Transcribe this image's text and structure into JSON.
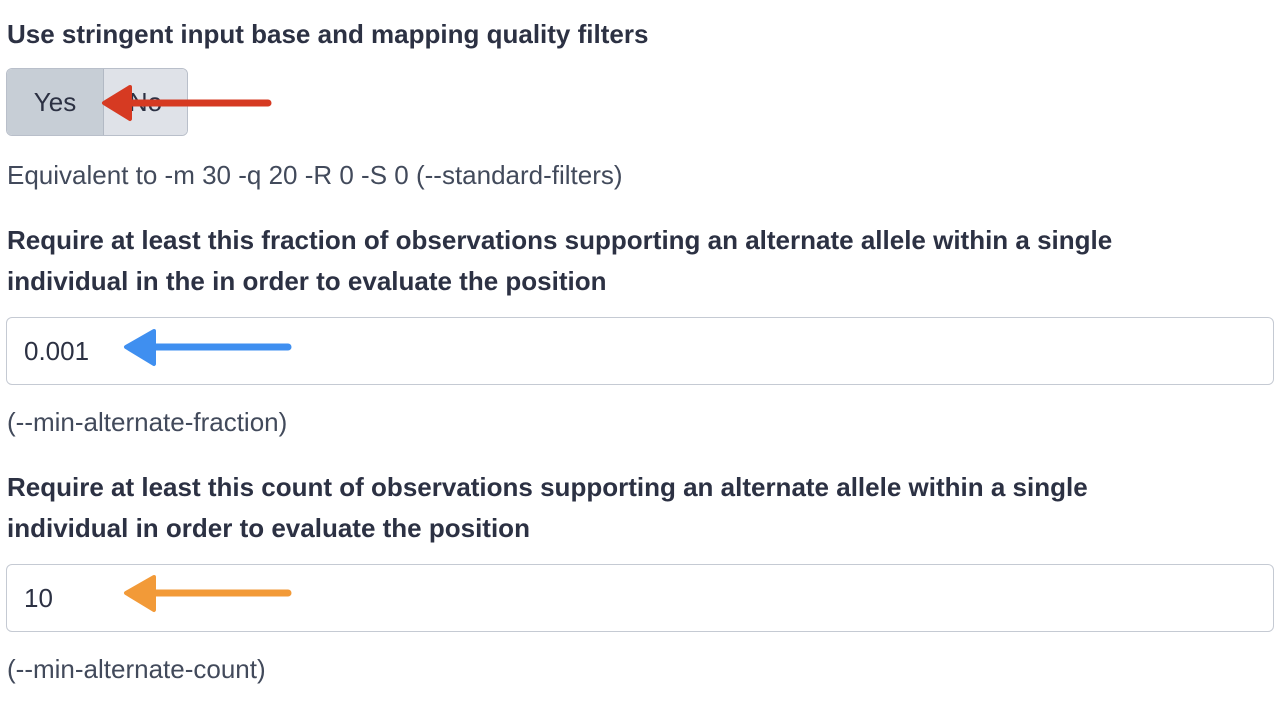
{
  "stringent_filters": {
    "label": "Use stringent input base and mapping quality filters",
    "options": [
      "Yes",
      "No"
    ],
    "selected": "Yes",
    "help": "Equivalent to -m 30 -q 20 -R 0 -S 0 (--standard-filters)"
  },
  "min_alternate_fraction": {
    "label_line1": "Require at least this fraction of observations supporting an alternate allele within a single",
    "label_line2": "individual in the in order to evaluate the position",
    "value": "0.001",
    "help": "(--min-alternate-fraction)"
  },
  "min_alternate_count": {
    "label_line1": "Require at least this count of observations supporting an alternate allele within a single",
    "label_line2": "individual in order to evaluate the position",
    "value": "10",
    "help": "(--min-alternate-count)"
  },
  "annotations": {
    "arrow_toggle_color": "#d63a22",
    "arrow_fraction_color": "#3f8ff0",
    "arrow_count_color": "#f29a38"
  }
}
